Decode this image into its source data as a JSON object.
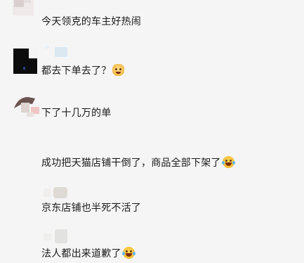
{
  "messages": [
    {
      "text": "今天领克的车主好热闹",
      "emoji": ""
    },
    {
      "text": "都去下单去了？",
      "emoji": "cat-face-emoji"
    },
    {
      "text": "下了十几万的单",
      "emoji": ""
    },
    {
      "text": "成功把天猫店铺干倒了，商品全部下架了",
      "emoji": "laughing-tears-emoji"
    },
    {
      "text": "京东店铺也半死不活了",
      "emoji": ""
    },
    {
      "text": "法人都出来道歉了",
      "emoji": "laughing-tears-emoji"
    }
  ],
  "colors": {
    "background": "#f5f5f5",
    "text": "#1a1a1a",
    "nickname_blur_blue": "#dbe8f2"
  }
}
